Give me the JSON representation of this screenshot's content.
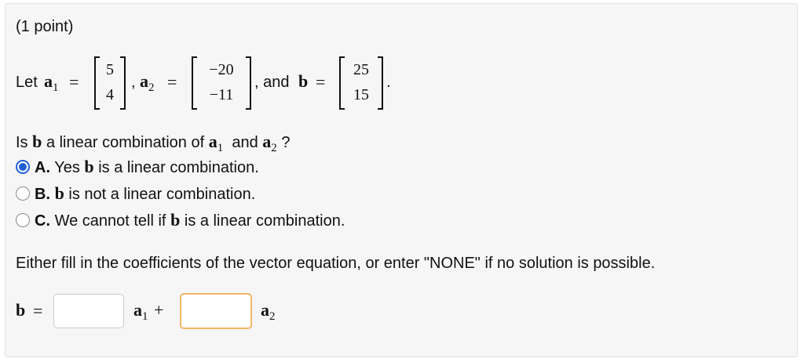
{
  "points": "(1 point)",
  "prompt": {
    "let": "Let",
    "a1": "a",
    "a1_sub": "1",
    "a2": "a",
    "a2_sub": "2",
    "b": "b",
    "equals": "=",
    "comma": ",",
    "and": ", and",
    "period": ".",
    "a1_entries": [
      "5",
      "4"
    ],
    "a2_entries": [
      "−20",
      "−11"
    ],
    "b_entries": [
      "25",
      "15"
    ]
  },
  "question": {
    "is": "Is",
    "b": "b",
    "text1": "a linear combination of",
    "a": "a",
    "a1_sub": "1",
    "and": "and",
    "a2_sub": "2",
    "qmark": "?"
  },
  "options": [
    {
      "letter": "A.",
      "pre": "Yes",
      "b": "b",
      "post": "is a linear combination.",
      "selected": true
    },
    {
      "letter": "B.",
      "pre": "",
      "b": "b",
      "post": "is not a linear combination.",
      "selected": false
    },
    {
      "letter": "C.",
      "pre": "We cannot tell if",
      "b": "b",
      "post": "is a linear combination.",
      "selected": false
    }
  ],
  "instruction": "Either fill in the coefficients of the vector equation, or enter \"NONE\" if no solution is possible.",
  "equation": {
    "b": "b",
    "equals": "=",
    "a": "a",
    "a1_sub": "1",
    "plus": "+",
    "a2_sub": "2",
    "coef1_value": "",
    "coef2_value": ""
  },
  "colors": {
    "radio_selected": "#1f5fd6",
    "focus_border": "#f2b766"
  }
}
